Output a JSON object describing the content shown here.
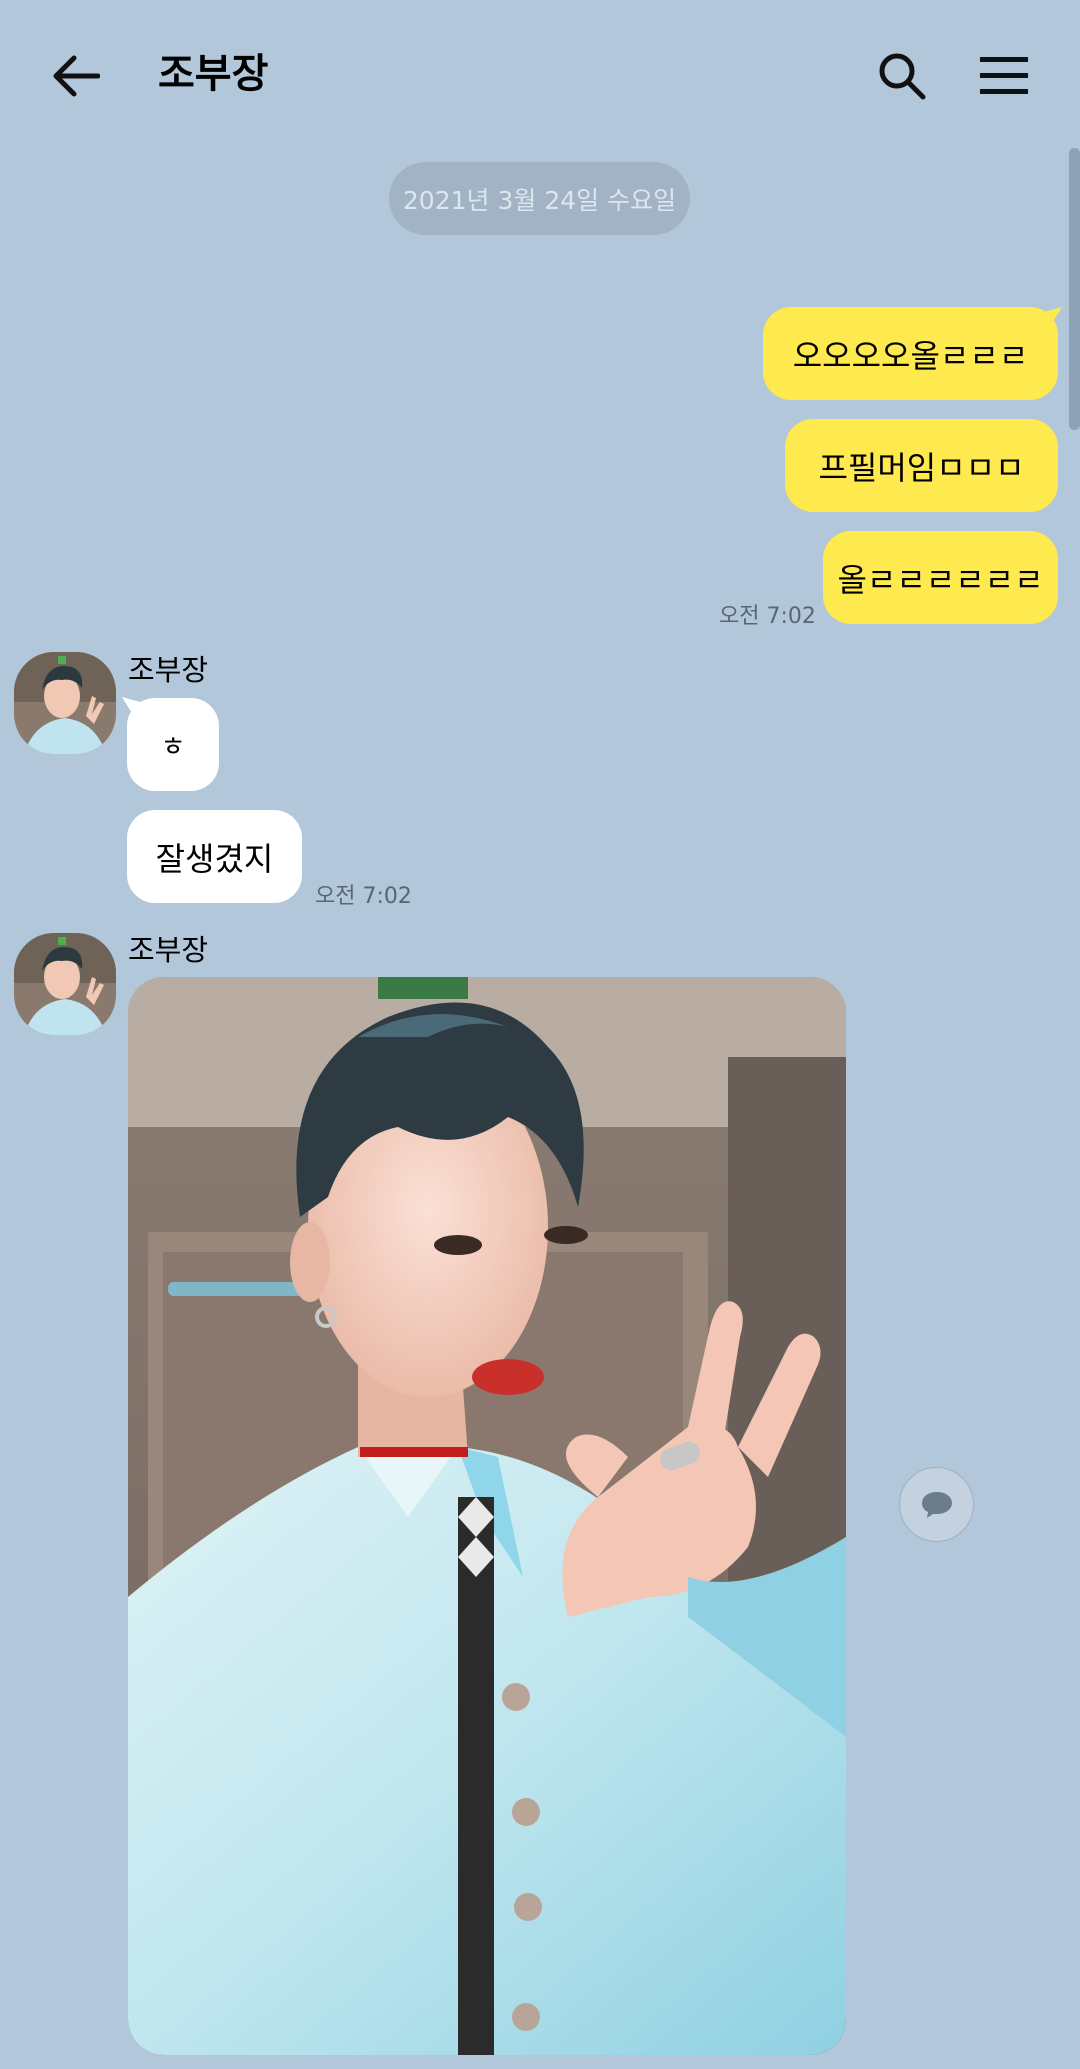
{
  "header": {
    "title": "조부장",
    "back_icon": "arrow-left-icon",
    "search_icon": "search-icon",
    "menu_icon": "hamburger-menu-icon"
  },
  "date_divider": "2021년 3월 24일 수요일",
  "messages": {
    "mine": [
      "오오오오올ㄹㄹㄹ",
      "프필머임ㅁㅁㅁ",
      "올ㄹㄹㄹㄹㄹㄹ"
    ],
    "mine_time": "오전 7:02",
    "group1": {
      "sender": "조부장",
      "bubbles": [
        "ㅎ",
        "잘생겼지"
      ],
      "time": "오전 7:02"
    },
    "group2": {
      "sender": "조부장"
    }
  },
  "colors": {
    "background": "#b2c7da",
    "my_bubble": "#fee94e",
    "their_bubble": "#ffffff"
  }
}
